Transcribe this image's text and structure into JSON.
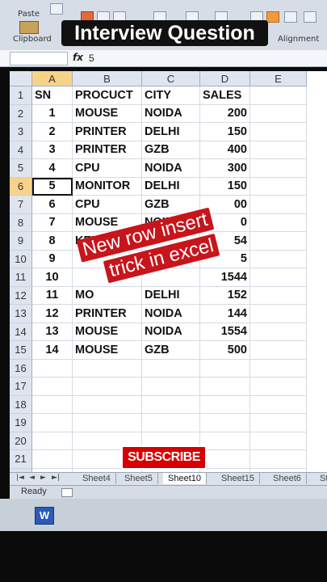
{
  "ribbon": {
    "paste_label": "Paste",
    "clipboard_label": "Clipboard",
    "alignment_label": "Alignment"
  },
  "overlay": {
    "title": "Interview Question",
    "tilt_line1": "New row insert",
    "tilt_line2": "trick in excel",
    "subscribe": "SUBSCRIBE"
  },
  "formula_bar": {
    "fx": "fx",
    "value": "5"
  },
  "columns": [
    "A",
    "B",
    "C",
    "D",
    "E"
  ],
  "rows": [
    {
      "n": "1",
      "a": "SN",
      "b": "PROCUCT",
      "c": "CITY",
      "d": "SALES"
    },
    {
      "n": "2",
      "a": "1",
      "b": "MOUSE",
      "c": "NOIDA",
      "d": "200"
    },
    {
      "n": "3",
      "a": "2",
      "b": "PRINTER",
      "c": "DELHI",
      "d": "150"
    },
    {
      "n": "4",
      "a": "3",
      "b": "PRINTER",
      "c": "GZB",
      "d": "400"
    },
    {
      "n": "5",
      "a": "4",
      "b": "CPU",
      "c": "NOIDA",
      "d": "300"
    },
    {
      "n": "6",
      "a": "5",
      "b": "MONITOR",
      "c": "DELHI",
      "d": "150"
    },
    {
      "n": "7",
      "a": "6",
      "b": "CPU",
      "c": "GZB",
      "d": "00"
    },
    {
      "n": "8",
      "a": "7",
      "b": "MOUSE",
      "c": "NOID",
      "d": "0"
    },
    {
      "n": "9",
      "a": "8",
      "b": "KEYBOA",
      "c": "",
      "d": "54"
    },
    {
      "n": "10",
      "a": "9",
      "b": "",
      "c": "",
      "d": "5"
    },
    {
      "n": "11",
      "a": "10",
      "b": "",
      "c": "",
      "d": "1544"
    },
    {
      "n": "12",
      "a": "11",
      "b": "MO",
      "c": "DELHI",
      "d": "152"
    },
    {
      "n": "13",
      "a": "12",
      "b": "PRINTER",
      "c": "NOIDA",
      "d": "144"
    },
    {
      "n": "14",
      "a": "13",
      "b": "MOUSE",
      "c": "NOIDA",
      "d": "1554"
    },
    {
      "n": "15",
      "a": "14",
      "b": "MOUSE",
      "c": "GZB",
      "d": "500"
    },
    {
      "n": "16",
      "a": "",
      "b": "",
      "c": "",
      "d": ""
    },
    {
      "n": "17",
      "a": "",
      "b": "",
      "c": "",
      "d": ""
    },
    {
      "n": "18",
      "a": "",
      "b": "",
      "c": "",
      "d": ""
    },
    {
      "n": "19",
      "a": "",
      "b": "",
      "c": "",
      "d": ""
    },
    {
      "n": "20",
      "a": "",
      "b": "",
      "c": "",
      "d": ""
    },
    {
      "n": "21",
      "a": "",
      "b": "",
      "c": "",
      "d": ""
    },
    {
      "n": "22",
      "a": "",
      "b": "",
      "c": "",
      "d": ""
    }
  ],
  "active_row": "6",
  "active_column": "A",
  "sheet_tabs": [
    "Sheet4",
    "Sheet5",
    "Sheet10",
    "Sheet15",
    "Sheet6",
    "St"
  ],
  "active_sheet": "Sheet10",
  "status": {
    "ready": "Ready"
  },
  "taskbar": {
    "word_icon_letter": "W"
  },
  "colors": {
    "overlay_red": "#c8141b",
    "subscribe_red": "#d60000",
    "selected_header": "#f7d38a"
  }
}
